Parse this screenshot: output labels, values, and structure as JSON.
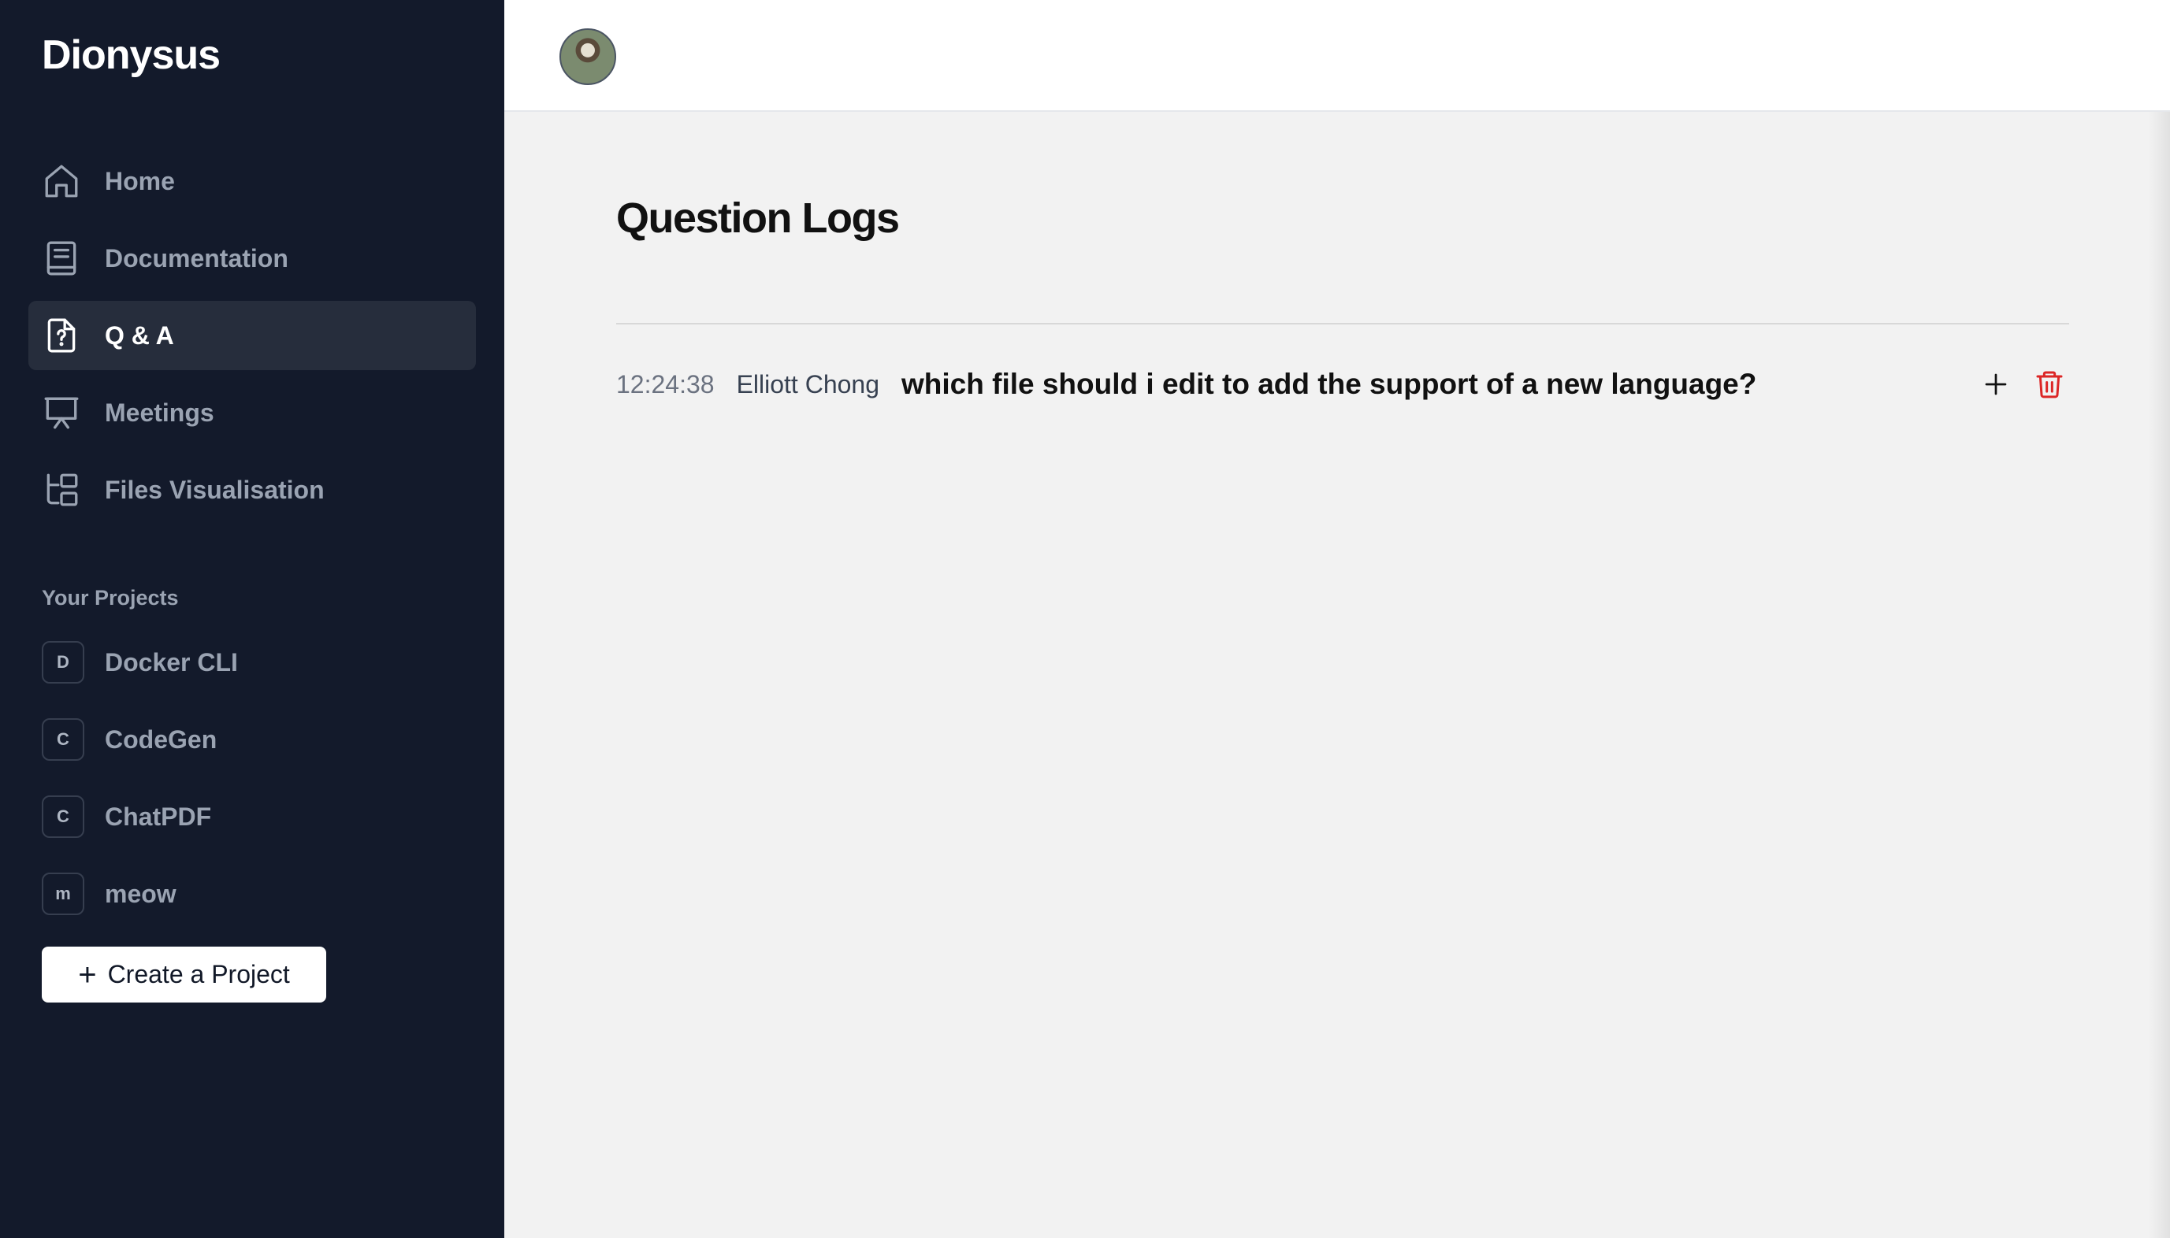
{
  "app": {
    "name": "Dionysus"
  },
  "nav": {
    "items": [
      {
        "label": "Home",
        "icon": "home-icon",
        "active": false
      },
      {
        "label": "Documentation",
        "icon": "document-icon",
        "active": false
      },
      {
        "label": "Q & A",
        "icon": "question-file-icon",
        "active": true
      },
      {
        "label": "Meetings",
        "icon": "presentation-icon",
        "active": false
      },
      {
        "label": "Files Visualisation",
        "icon": "folder-tree-icon",
        "active": false
      }
    ]
  },
  "projects": {
    "heading": "Your Projects",
    "items": [
      {
        "initial": "D",
        "name": "Docker CLI"
      },
      {
        "initial": "C",
        "name": "CodeGen"
      },
      {
        "initial": "C",
        "name": "ChatPDF"
      },
      {
        "initial": "m",
        "name": "meow"
      }
    ],
    "create_label": "Create a Project"
  },
  "page": {
    "title": "Question Logs"
  },
  "logs": [
    {
      "time": "12:24:38",
      "user": "Elliott Chong",
      "question": "which file should i edit to add the support of a new language?"
    }
  ],
  "colors": {
    "sidebar_bg": "#131a2b",
    "active_item_bg": "#262d3c",
    "delete_red": "#dc2626"
  }
}
